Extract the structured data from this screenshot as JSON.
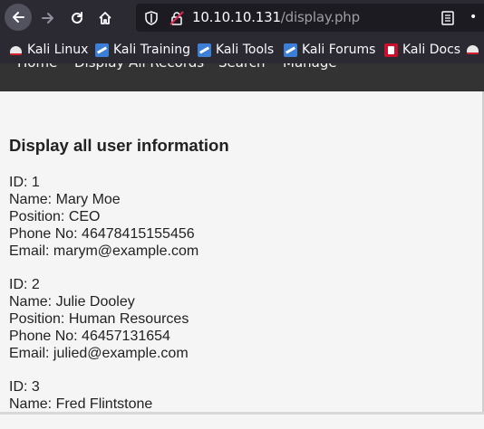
{
  "browser": {
    "url_host": "10.10.10.131",
    "url_path": "/display.php",
    "more_glyph": "•",
    "bookmarks": [
      {
        "label": "Kali Linux",
        "icon": "kali-dragon-icon"
      },
      {
        "label": "Kali Training",
        "icon": "kali-training-icon"
      },
      {
        "label": "Kali Tools",
        "icon": "kali-training-icon"
      },
      {
        "label": "Kali Forums",
        "icon": "kali-training-icon"
      },
      {
        "label": "Kali Docs",
        "icon": "kali-docs-icon"
      }
    ]
  },
  "site_nav": {
    "items": [
      "Home",
      "Display All Records",
      "Search",
      "Manage"
    ]
  },
  "page": {
    "heading": "Display all user information",
    "records": [
      {
        "id": "ID: 1",
        "name": "Name: Mary Moe",
        "position": "Position: CEO",
        "phone": "Phone No: 46478415155456",
        "email": "Email: marym@example.com"
      },
      {
        "id": "ID: 2",
        "name": "Name: Julie Dooley",
        "position": "Position: Human Resources",
        "phone": "Phone No: 46457131654",
        "email": "Email: julied@example.com"
      },
      {
        "id": "ID: 3",
        "name": "Name: Fred Flintstone"
      }
    ]
  },
  "colors": {
    "chrome_bg": "#2b2a33",
    "urlbar_bg": "#1c1b22",
    "nav_bg": "#333333",
    "page_bg": "#f5f5f5"
  }
}
